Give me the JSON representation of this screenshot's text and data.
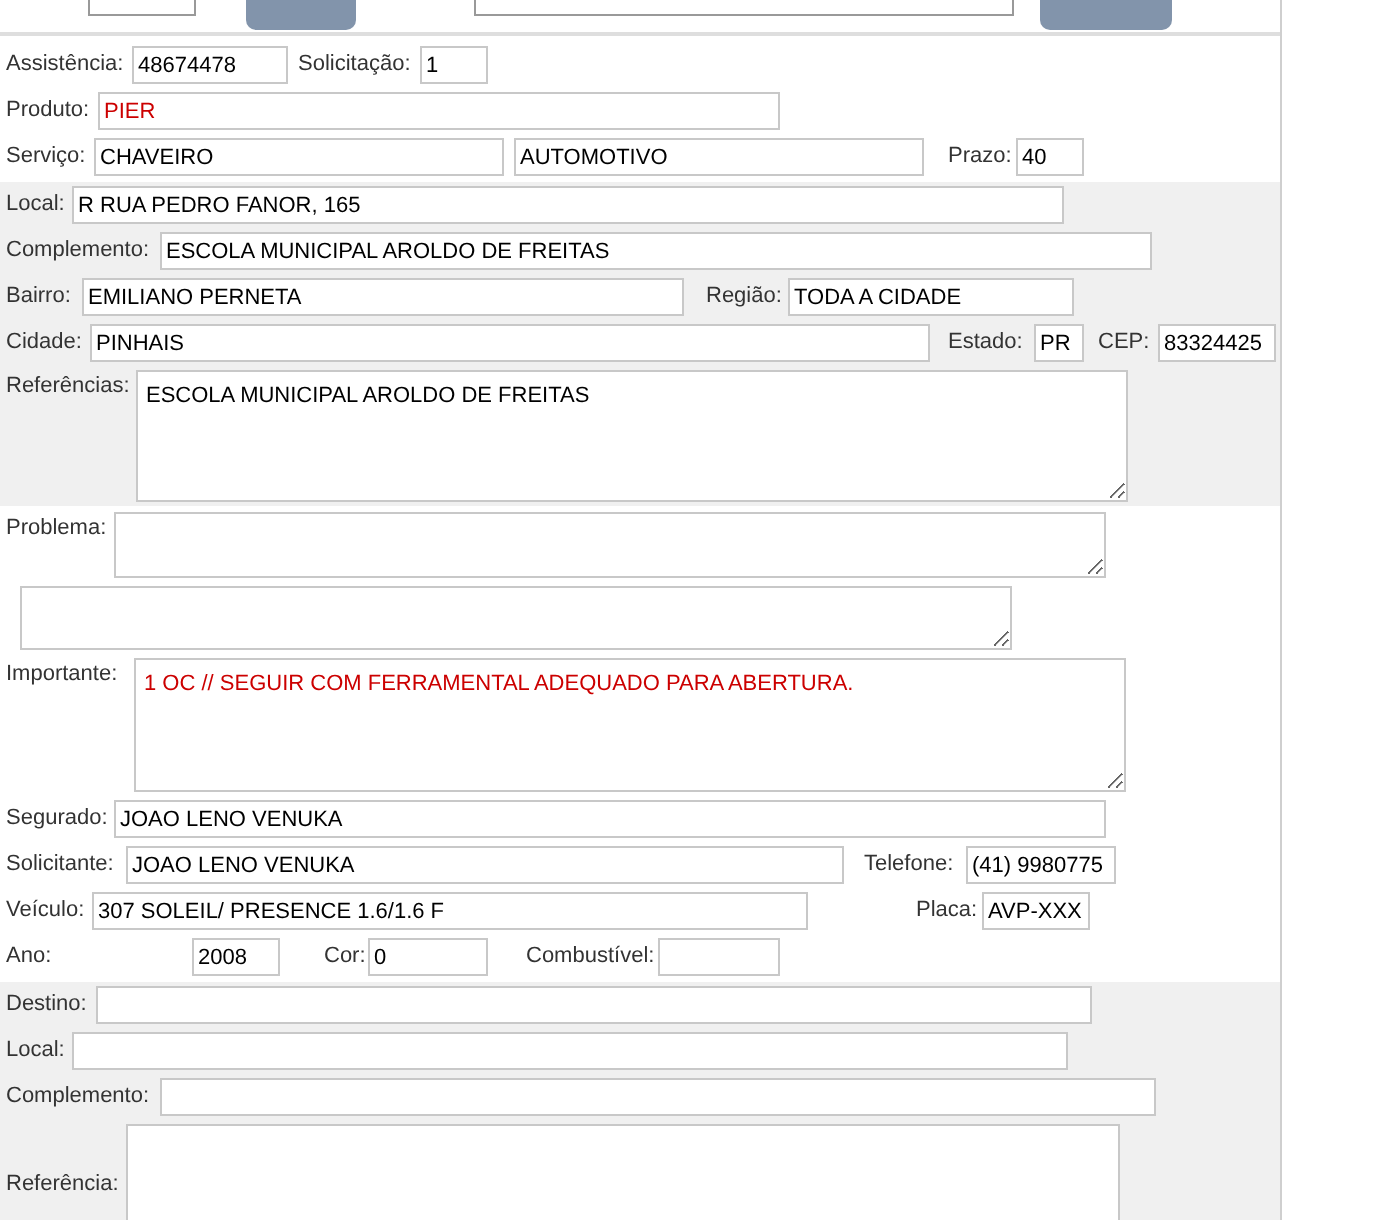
{
  "sections": [
    {
      "rows": [
        [
          {
            "label": "Assistência:",
            "value": "48674478",
            "alert": false
          },
          {
            "label": "Solicitação:",
            "value": "1",
            "alert": false
          }
        ],
        [
          {
            "label": "Produto:",
            "value": "PIER",
            "alert": true
          }
        ],
        [
          {
            "label": "Serviço:",
            "value": "CHAVEIRO",
            "alert": false
          },
          {
            "value": "AUTOMOTIVO",
            "alert": false
          },
          {
            "label": "Prazo:",
            "value": "40",
            "alert": false
          }
        ]
      ]
    },
    {
      "rows": [
        [
          {
            "label": "Local:",
            "value": "R RUA PEDRO FANOR, 165",
            "alert": false
          }
        ],
        [
          {
            "label": "Complemento:",
            "value": "ESCOLA MUNICIPAL AROLDO DE FREITAS",
            "alert": false
          }
        ],
        [
          {
            "label": "Bairro:",
            "value": "EMILIANO PERNETA",
            "alert": false
          },
          {
            "label": "Região:",
            "value": "TODA A CIDADE",
            "alert": false
          }
        ],
        [
          {
            "label": "Cidade:",
            "value": "PINHAIS",
            "alert": false
          },
          {
            "label": "Estado:",
            "value": "PR",
            "alert": false
          },
          {
            "label": "CEP:",
            "value": "83324425",
            "alert": false
          }
        ],
        [
          {
            "kind": "textarea",
            "label": "Referências:",
            "value": "ESCOLA MUNICIPAL AROLDO DE FREITAS",
            "alert": false
          }
        ]
      ]
    },
    {
      "rows": [
        [
          {
            "kind": "textarea",
            "label": "Problema:"
          }
        ],
        [
          {
            "kind": "textarea"
          }
        ],
        [
          {
            "kind": "textarea",
            "label": "Importante:",
            "value": "1 OC // SEGUIR COM FERRAMENTAL ADEQUADO PARA ABERTURA.",
            "alert": true
          }
        ],
        [
          {
            "label": "Segurado:",
            "value": "JOAO LENO VENUKA",
            "alert": false
          }
        ],
        [
          {
            "label": "Solicitante:",
            "value": "JOAO LENO VENUKA",
            "alert": false
          },
          {
            "label": "Telefone:",
            "value": "(41) 9980775",
            "alert": false
          }
        ],
        [
          {
            "label": "Veículo:",
            "value": "307 SOLEIL/ PRESENCE 1.6/1.6 F",
            "alert": false
          },
          {
            "label": "Placa:",
            "value": "AVP-XXX",
            "alert": false
          }
        ],
        [
          {
            "label": "Ano:",
            "value": "2008",
            "alert": false
          },
          {
            "label": "Cor:",
            "value": "0",
            "alert": false
          },
          {
            "label": "Combustível:"
          }
        ]
      ]
    },
    {
      "rows": [
        [
          {
            "label": "Destino:"
          }
        ],
        [
          {
            "label": "Local:"
          }
        ],
        [
          {
            "label": "Complemento:"
          }
        ],
        [
          {
            "kind": "textarea",
            "label": "Referência:"
          }
        ]
      ]
    }
  ]
}
